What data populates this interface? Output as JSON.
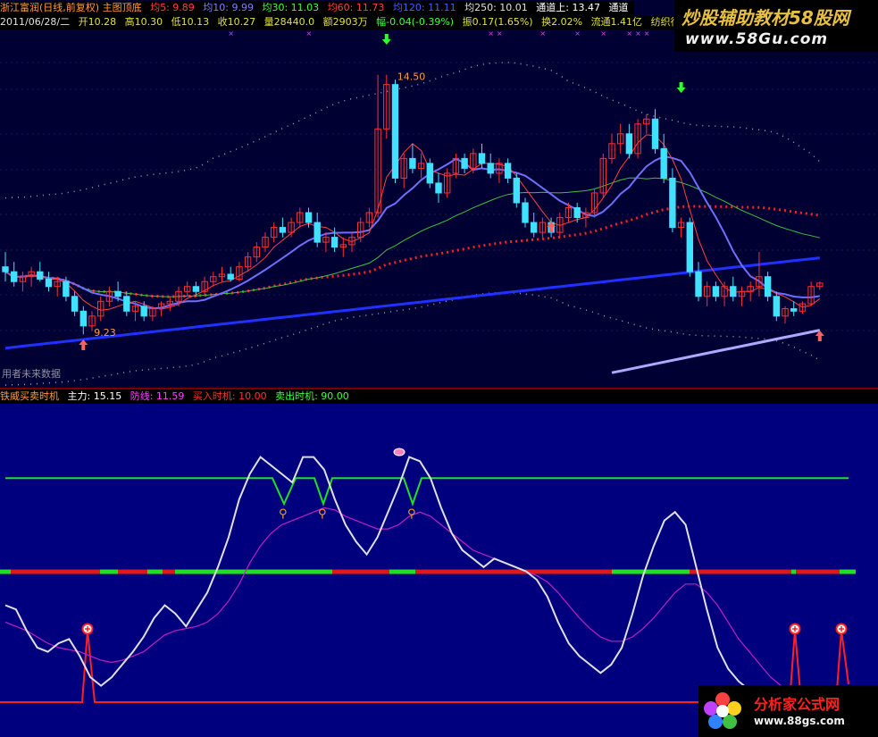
{
  "header": {
    "stock_title": "浙江富润(日线,前复权) 主图顶底",
    "ma5": "均5: 9.89",
    "ma10": "均10: 9.99",
    "ma30": "均30: 11.03",
    "ma60": "均60: 11.73",
    "ma120": "均120: 11.11",
    "ma250": "均250: 10.01",
    "channel_up": "通道上: 13.47",
    "channel_mid": "通道",
    "quote_date": "2011/06/28/二",
    "open": "开10.28",
    "high": "高10.30",
    "low": "低10.13",
    "close": "收10.27",
    "volume": "量28440.0",
    "amount": "额2903万",
    "change": "幅-0.04(-0.39%)",
    "amplitude": "振0.17(1.65%)",
    "turnover": "换2.02%",
    "float_cap": "流通1.41亿",
    "industry": "纺织行业"
  },
  "main_chart": {
    "no_data_label": "用者未来数据"
  },
  "sub_header": {
    "indicator_name": "铁威买卖时机",
    "main_force": "主力: 15.15",
    "defense": "防线: 11.59",
    "buy_timing": "买入时机: 10.00",
    "sell_timing": "卖出时机: 90.00"
  },
  "watermarks": {
    "top_title": "炒股辅助教材58股网",
    "top_url": "www.58Gu.com",
    "bottom_title": "分析家公式网",
    "bottom_url": "www.88gs.com"
  },
  "colors": {
    "main_bg": "#000033",
    "sub_bg": "#00007f",
    "up": "#ff3030",
    "down": "#40e0ff",
    "ma5": "#ffffff",
    "ma10": "#6f6fff",
    "ma30": "#40c040",
    "ma60": "#ff2020",
    "ma250": "#2030ff",
    "channel": "#a0a0a0",
    "hline_green": "#20e020",
    "mainforce": "#e0e0e0",
    "defense": "#c020c0"
  },
  "chart_data": [
    {
      "type": "candlestick",
      "ylim": [
        8.4,
        15.4
      ],
      "candles": [
        [
          10.6,
          10.9,
          10.3,
          10.5
        ],
        [
          10.5,
          10.7,
          10.2,
          10.3
        ],
        [
          10.3,
          10.5,
          10.1,
          10.4
        ],
        [
          10.4,
          10.6,
          10.2,
          10.5
        ],
        [
          10.5,
          10.7,
          10.3,
          10.35
        ],
        [
          10.35,
          10.5,
          10.1,
          10.2
        ],
        [
          10.2,
          10.4,
          10.0,
          10.3
        ],
        [
          10.3,
          10.4,
          9.9,
          10.0
        ],
        [
          10.0,
          10.1,
          9.6,
          9.7
        ],
        [
          9.7,
          9.8,
          9.23,
          9.4
        ],
        [
          9.4,
          9.7,
          9.3,
          9.6
        ],
        [
          9.6,
          10.0,
          9.5,
          9.9
        ],
        [
          9.9,
          10.2,
          9.8,
          10.1
        ],
        [
          10.1,
          10.3,
          9.9,
          10.0
        ],
        [
          10.0,
          10.1,
          9.6,
          9.7
        ],
        [
          9.7,
          9.9,
          9.5,
          9.8
        ],
        [
          9.8,
          9.9,
          9.5,
          9.6
        ],
        [
          9.6,
          9.8,
          9.5,
          9.75
        ],
        [
          9.75,
          9.9,
          9.6,
          9.85
        ],
        [
          9.85,
          10.0,
          9.7,
          9.9
        ],
        [
          9.9,
          10.2,
          9.8,
          10.1
        ],
        [
          10.1,
          10.3,
          10.0,
          10.2
        ],
        [
          10.2,
          10.3,
          10.0,
          10.1
        ],
        [
          10.1,
          10.4,
          10.0,
          10.3
        ],
        [
          10.3,
          10.5,
          10.2,
          10.4
        ],
        [
          10.4,
          10.6,
          10.3,
          10.45
        ],
        [
          10.45,
          10.6,
          10.3,
          10.35
        ],
        [
          10.35,
          10.7,
          10.3,
          10.6
        ],
        [
          10.6,
          10.9,
          10.5,
          10.8
        ],
        [
          10.8,
          11.1,
          10.7,
          11.0
        ],
        [
          11.0,
          11.3,
          10.9,
          11.2
        ],
        [
          11.2,
          11.5,
          11.1,
          11.4
        ],
        [
          11.4,
          11.6,
          11.2,
          11.3
        ],
        [
          11.3,
          11.6,
          11.2,
          11.5
        ],
        [
          11.5,
          11.8,
          11.4,
          11.7
        ],
        [
          11.7,
          11.8,
          11.4,
          11.5
        ],
        [
          11.5,
          11.7,
          11.0,
          11.1
        ],
        [
          11.1,
          11.3,
          10.9,
          11.2
        ],
        [
          11.2,
          11.4,
          10.9,
          11.0
        ],
        [
          11.0,
          11.2,
          10.8,
          11.05
        ],
        [
          11.05,
          11.3,
          10.9,
          11.2
        ],
        [
          11.2,
          11.6,
          11.1,
          11.5
        ],
        [
          11.5,
          11.8,
          11.4,
          11.7
        ],
        [
          11.7,
          14.5,
          11.6,
          13.4
        ],
        [
          13.4,
          14.5,
          13.2,
          14.3
        ],
        [
          14.3,
          14.4,
          12.3,
          12.4
        ],
        [
          12.4,
          12.9,
          12.2,
          12.8
        ],
        [
          12.8,
          13.1,
          12.5,
          12.6
        ],
        [
          12.6,
          12.9,
          12.4,
          12.7
        ],
        [
          12.7,
          12.8,
          12.2,
          12.3
        ],
        [
          12.3,
          12.5,
          11.9,
          12.1
        ],
        [
          12.1,
          12.6,
          12.0,
          12.5
        ],
        [
          12.5,
          12.9,
          12.4,
          12.8
        ],
        [
          12.8,
          12.9,
          12.5,
          12.6
        ],
        [
          12.6,
          13.0,
          12.5,
          12.9
        ],
        [
          12.9,
          13.1,
          12.6,
          12.7
        ],
        [
          12.7,
          12.9,
          12.4,
          12.5
        ],
        [
          12.5,
          12.8,
          12.3,
          12.7
        ],
        [
          12.7,
          12.8,
          12.3,
          12.4
        ],
        [
          12.4,
          12.5,
          11.8,
          11.9
        ],
        [
          11.9,
          12.0,
          11.4,
          11.5
        ],
        [
          11.5,
          11.7,
          11.2,
          11.3
        ],
        [
          11.3,
          11.6,
          11.2,
          11.5
        ],
        [
          11.5,
          11.6,
          11.2,
          11.3
        ],
        [
          11.3,
          11.7,
          11.2,
          11.6
        ],
        [
          11.6,
          11.9,
          11.5,
          11.8
        ],
        [
          11.8,
          11.9,
          11.5,
          11.6
        ],
        [
          11.6,
          11.8,
          11.4,
          11.7
        ],
        [
          11.7,
          12.2,
          11.6,
          12.1
        ],
        [
          12.1,
          12.9,
          12.0,
          12.8
        ],
        [
          12.8,
          13.3,
          12.7,
          13.1
        ],
        [
          13.1,
          13.5,
          12.9,
          13.3
        ],
        [
          13.3,
          13.5,
          12.8,
          12.9
        ],
        [
          12.9,
          13.6,
          12.8,
          13.5
        ],
        [
          13.5,
          13.7,
          13.3,
          13.6
        ],
        [
          13.6,
          13.8,
          12.9,
          13.0
        ],
        [
          13.0,
          13.3,
          12.3,
          12.4
        ],
        [
          12.4,
          12.6,
          11.3,
          11.4
        ],
        [
          11.4,
          11.6,
          11.2,
          11.5
        ],
        [
          11.5,
          11.6,
          10.4,
          10.5
        ],
        [
          10.5,
          10.7,
          9.9,
          10.0
        ],
        [
          10.0,
          10.3,
          9.8,
          10.2
        ],
        [
          10.2,
          10.3,
          9.9,
          10.0
        ],
        [
          10.0,
          10.3,
          9.8,
          10.2
        ],
        [
          10.2,
          10.4,
          9.9,
          10.0
        ],
        [
          10.0,
          10.2,
          9.8,
          10.1
        ],
        [
          10.1,
          10.3,
          9.9,
          10.2
        ],
        [
          10.2,
          10.9,
          10.0,
          10.4
        ],
        [
          10.4,
          10.5,
          9.9,
          10.0
        ],
        [
          10.0,
          10.1,
          9.5,
          9.6
        ],
        [
          9.6,
          9.8,
          9.45,
          9.75
        ],
        [
          9.75,
          9.9,
          9.6,
          9.7
        ],
        [
          9.7,
          9.9,
          9.65,
          9.85
        ],
        [
          9.85,
          10.3,
          9.8,
          10.2
        ],
        [
          10.2,
          10.3,
          10.13,
          10.27
        ]
      ],
      "annotations": [
        {
          "text": "14.50",
          "index": 44,
          "value": 14.5
        },
        {
          "text": "9.23",
          "index": 9,
          "value": 9.23
        }
      ]
    },
    {
      "type": "line",
      "ylim": [
        -20,
        115
      ],
      "series": [
        {
          "name": "主力",
          "values": [
            30,
            28,
            18,
            10,
            8,
            12,
            14,
            6,
            -4,
            -8,
            -4,
            2,
            8,
            15,
            24,
            30,
            26,
            20,
            28,
            36,
            48,
            62,
            80,
            92,
            100,
            96,
            92,
            88,
            100,
            100,
            94,
            80,
            68,
            60,
            54,
            62,
            74,
            86,
            100,
            98,
            90,
            76,
            64,
            56,
            52,
            48,
            52,
            50,
            48,
            46,
            42,
            34,
            22,
            12,
            6,
            2,
            -2,
            2,
            10,
            26,
            44,
            58,
            70,
            74,
            68,
            48,
            28,
            10,
            0,
            -6,
            -10,
            -16,
            -20,
            -24,
            -28,
            -32,
            -34,
            -36,
            -38,
            -40
          ]
        },
        {
          "name": "防线",
          "values": [
            22,
            20,
            18,
            15,
            12,
            10,
            9,
            8,
            6,
            4,
            3,
            4,
            6,
            8,
            12,
            16,
            18,
            19,
            20,
            22,
            26,
            32,
            40,
            50,
            58,
            64,
            68,
            70,
            72,
            74,
            76,
            75,
            72,
            70,
            68,
            66,
            66,
            68,
            72,
            74,
            72,
            68,
            64,
            60,
            56,
            54,
            52,
            50,
            48,
            46,
            44,
            41,
            36,
            30,
            24,
            19,
            15,
            13,
            13,
            15,
            19,
            24,
            30,
            36,
            40,
            40,
            36,
            30,
            22,
            14,
            8,
            2,
            -4,
            -8,
            -12,
            -16,
            -18,
            -20,
            -22,
            -24
          ]
        }
      ],
      "levels": [
        {
          "name": "买入时机",
          "value": 10
        },
        {
          "name": "卖出时机",
          "value": 90
        }
      ]
    }
  ]
}
